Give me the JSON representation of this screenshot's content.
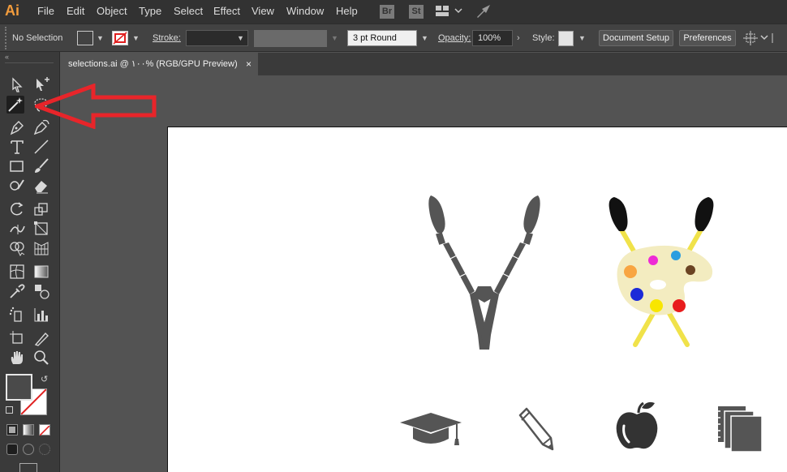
{
  "app": {
    "logo": "Ai"
  },
  "menu": {
    "items": [
      "File",
      "Edit",
      "Object",
      "Type",
      "Select",
      "Effect",
      "View",
      "Window",
      "Help"
    ],
    "bridge": "Br",
    "stock": "St"
  },
  "control_bar": {
    "selection_status": "No Selection",
    "stroke_label": "Stroke:",
    "brush_value": "3 pt Round",
    "opacity_label": "Opacity:",
    "opacity_value": "100%",
    "style_label": "Style:",
    "document_setup": "Document Setup",
    "preferences": "Preferences"
  },
  "document": {
    "tab_title": "selections.ai @ ۱۰۰% (RGB/GPU Preview)",
    "close": "×"
  },
  "colors": {
    "ui_dark": "#323232",
    "panel": "#424242",
    "canvas": "#535353",
    "accent_logo": "#f39c3c",
    "annotation_arrow": "#e8252a",
    "icon_gray": "#555555",
    "palette_cream": "#f3ecc0",
    "brush_yellow": "#f0e24a"
  },
  "palette_dots": [
    "#f8a541",
    "#ee2bd5",
    "#2a9ee0",
    "#6b4423",
    "#1c2bd8",
    "#f8e600",
    "#e81c1c"
  ],
  "tools": [
    "selection-tool",
    "direct-selection-tool",
    "magic-wand-tool",
    "lasso-tool",
    "pen-tool",
    "curvature-tool",
    "type-tool",
    "line-segment-tool",
    "rectangle-tool",
    "paintbrush-tool",
    "shaper-tool",
    "eraser-tool",
    "rotate-tool",
    "scale-tool",
    "width-tool",
    "free-transform-tool",
    "shape-builder-tool",
    "perspective-grid-tool",
    "mesh-tool",
    "gradient-tool",
    "eyedropper-tool",
    "blend-tool",
    "symbol-sprayer-tool",
    "column-graph-tool",
    "artboard-tool",
    "slice-tool",
    "hand-tool",
    "zoom-tool"
  ],
  "active_tool": "magic-wand-tool"
}
